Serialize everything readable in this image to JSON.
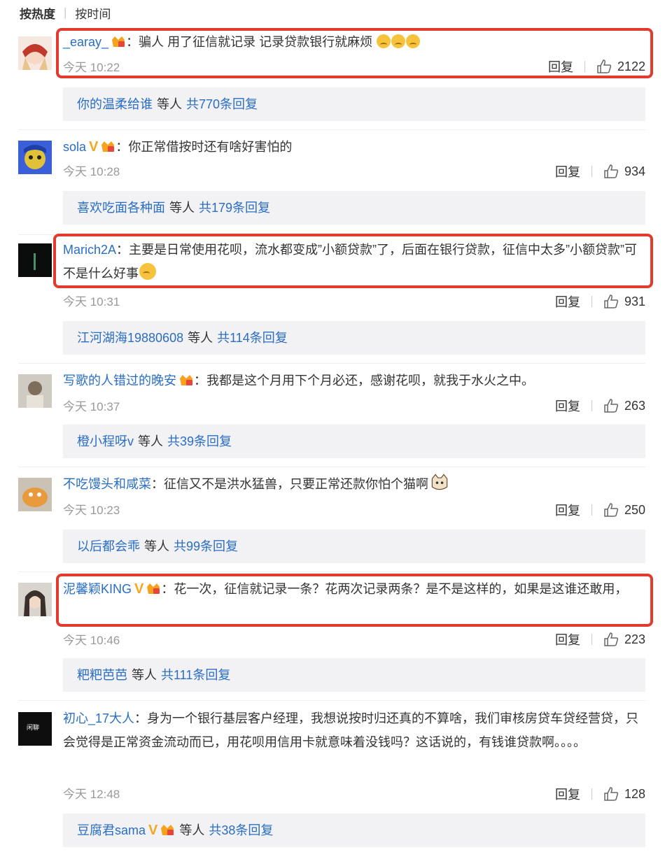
{
  "sort": {
    "active": "按热度",
    "option": "按时间"
  },
  "comments": [
    {
      "user": "_earay_",
      "text": "：骗人 用了征信就记录 记录贷款银行就麻烦 ",
      "time": "今天 10:22",
      "reply_label": "回复",
      "likes": "2122",
      "sub": {
        "name": "你的温柔给谁",
        "etc": "等人",
        "count": "共770条回复"
      }
    },
    {
      "user": "sola",
      "text": "：你正常借按时还有啥好害怕的",
      "time": "今天 10:28",
      "reply_label": "回复",
      "likes": "934",
      "sub": {
        "name": "喜欢吃面各种面",
        "etc": "等人",
        "count": "共179条回复"
      }
    },
    {
      "user": "Marich2A",
      "text": "：主要是日常使用花呗，流水都变成”小额贷款”了，后面在银行贷款，征信中太多”小额贷款”可不是什么好事",
      "time": "今天 10:31",
      "reply_label": "回复",
      "likes": "931",
      "sub": {
        "name": "江河湖海19880608",
        "etc": "等人",
        "count": "共114条回复"
      }
    },
    {
      "user": "写歌的人错过的晚安",
      "text": "：我都是这个月用下个月必还，感谢花呗，就我于水火之中。",
      "time": "今天 10:37",
      "reply_label": "回复",
      "likes": "263",
      "sub": {
        "name": "橙小程呀v",
        "etc": "等人",
        "count": "共39条回复"
      }
    },
    {
      "user": "不吃馒头和咸菜",
      "text": "：征信又不是洪水猛兽，只要正常还款你怕个猫啊",
      "time": "今天 10:23",
      "reply_label": "回复",
      "likes": "250",
      "sub": {
        "name": "以后都会乖",
        "etc": "等人",
        "count": "共99条回复"
      }
    },
    {
      "user": "泥馨颖KING",
      "text": "：花一次，征信就记录一条？花两次记录两条？是不是这样的，如果是这谁还敢用，",
      "time": "今天 10:46",
      "reply_label": "回复",
      "likes": "223",
      "sub": {
        "name": "粑粑芭芭",
        "etc": "等人",
        "count": "共111条回复"
      }
    },
    {
      "user": "初心_17大人",
      "text": "：身为一个银行基层客户经理，我想说按时归还真的不算啥，我们审核房贷车贷经营贷，只会觉得是正常资金流动而已，用花呗用信用卡就意味着没钱吗？这话说的，有钱谁贷款啊。。。。",
      "time": "今天 12:48",
      "reply_label": "回复",
      "likes": "128",
      "sub": {
        "name": "豆腐君sama",
        "etc": "等人",
        "count": "共38条回复"
      }
    }
  ],
  "avatar_text_7": "闲聊",
  "colors": {
    "link": "#2a6dc4",
    "highlight": "#e23b2e",
    "reply_bg": "#f2f2f5"
  }
}
